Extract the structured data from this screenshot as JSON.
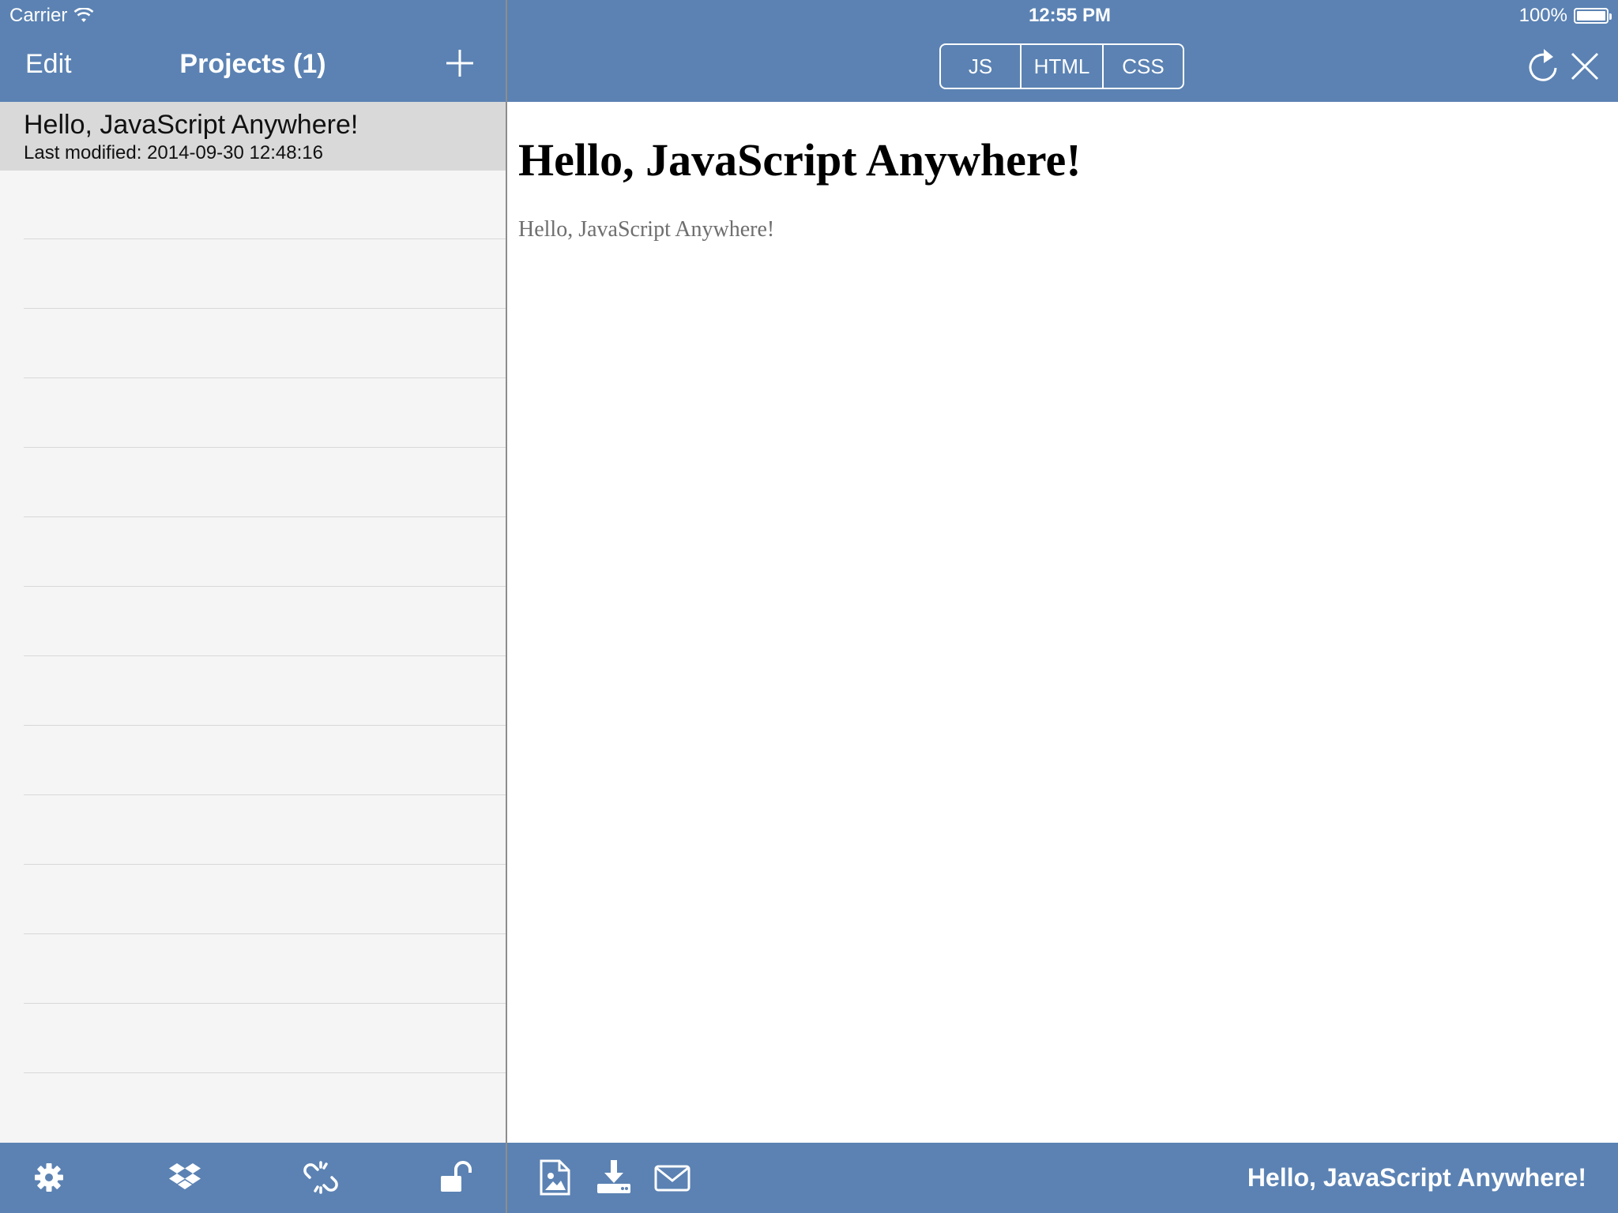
{
  "status_bar": {
    "carrier": "Carrier",
    "time": "12:55 PM",
    "battery_text": "100%",
    "battery_level": 1.0
  },
  "projects_nav": {
    "edit_label": "Edit",
    "title": "Projects (1)",
    "add_icon": "plus-icon"
  },
  "projects": [
    {
      "title": "Hello, JavaScript Anywhere!",
      "modified": "Last modified: 2014-09-30 12:48:16"
    }
  ],
  "left_toolbar": {
    "icons": [
      "gear-icon",
      "dropbox-icon",
      "unlink-icon",
      "unlock-icon"
    ]
  },
  "editor_nav": {
    "tabs": [
      "JS",
      "HTML",
      "CSS"
    ],
    "refresh_icon": "refresh-icon",
    "close_icon": "close-icon"
  },
  "preview": {
    "heading": "Hello, JavaScript Anywhere!",
    "paragraph": "Hello, JavaScript Anywhere!"
  },
  "right_toolbar": {
    "icons": [
      "image-file-icon",
      "download-icon",
      "mail-icon"
    ],
    "project_title": "Hello, JavaScript Anywhere!"
  },
  "colors": {
    "bar": "#5b82b3",
    "selected_row": "#d9d9d9",
    "list_bg": "#f5f5f5"
  }
}
